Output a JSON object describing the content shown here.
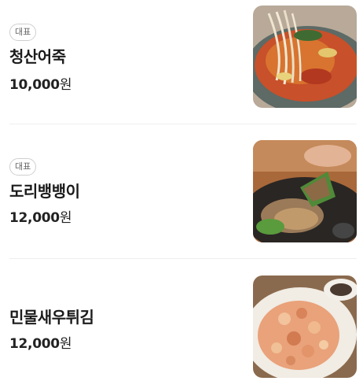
{
  "menu": {
    "items": [
      {
        "badge": "대표",
        "name": "청산어죽",
        "price": "10,000",
        "unit": "원",
        "image_icon": "fish-porridge-photo"
      },
      {
        "badge": "대표",
        "name": "도리뱅뱅이",
        "price": "12,000",
        "unit": "원",
        "image_icon": "fried-fish-photo"
      },
      {
        "name": "민물새우튀김",
        "price": "12,000",
        "unit": "원",
        "image_icon": "fried-shrimp-photo"
      }
    ]
  }
}
